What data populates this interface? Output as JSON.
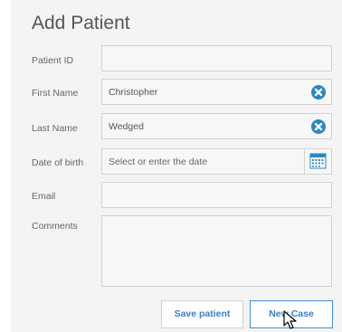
{
  "form": {
    "title": "Add Patient",
    "fields": {
      "patient_id": {
        "label": "Patient ID",
        "value": ""
      },
      "first_name": {
        "label": "First Name",
        "value": "Christopher"
      },
      "last_name": {
        "label": "Last Name",
        "value": "Wedged"
      },
      "dob": {
        "label": "Date of birth",
        "placeholder": "Select or enter the date"
      },
      "email": {
        "label": "Email",
        "value": ""
      },
      "comments": {
        "label": "Comments",
        "value": ""
      }
    }
  },
  "actions": {
    "save_label": "Save patient",
    "new_case_label": "New Case"
  },
  "colors": {
    "accent": "#2e86c1",
    "button_text": "#3a7fc1"
  },
  "icons": {
    "clear": "clear-x-icon",
    "calendar": "calendar-icon",
    "cursor": "mouse-pointer-icon"
  }
}
